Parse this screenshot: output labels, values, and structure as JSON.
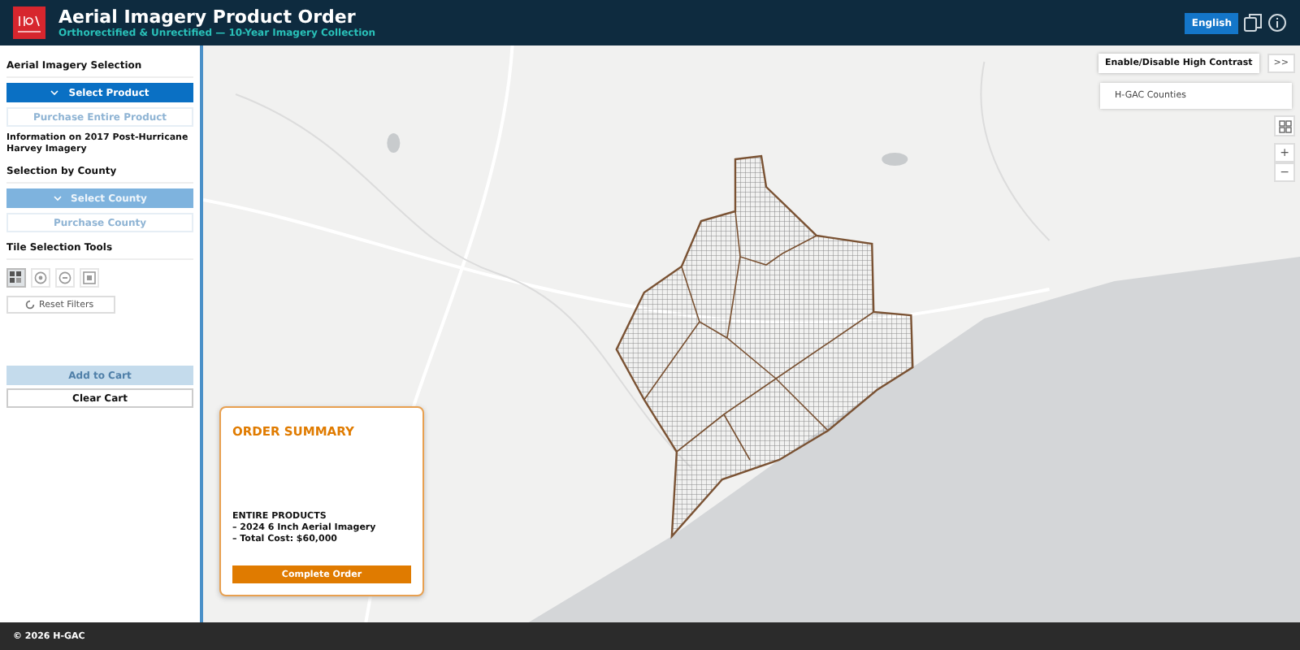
{
  "header": {
    "title": "Aerial Imagery Product Order",
    "subtitle": "Orthorectified & Unrectified — 10-Year Imagery Collection",
    "language_button": "English"
  },
  "sidebar": {
    "sections": [
      {
        "heading": "Aerial Imagery Selection",
        "buttons": [
          {
            "label": "Select Product",
            "kind": "dropdown",
            "disabled": false
          },
          {
            "label": "Purchase Entire Product",
            "kind": "plain",
            "disabled": true
          }
        ],
        "info": "Information on 2017 Post-Hurricane Harvey Imagery"
      },
      {
        "heading": "Selection by County",
        "buttons": [
          {
            "label": "Select County",
            "kind": "dropdown",
            "disabled": true
          },
          {
            "label": "Purchase County",
            "kind": "plain",
            "disabled": true
          }
        ]
      },
      {
        "heading": "Tile Selection Tools",
        "tools": [
          {
            "kind": "grid",
            "selected": true
          },
          {
            "kind": "add",
            "selected": false
          },
          {
            "kind": "remove",
            "selected": false
          },
          {
            "kind": "extent",
            "selected": false
          }
        ],
        "reset_button": "Reset Filters"
      }
    ],
    "cart_buttons": [
      {
        "label": "Add to Cart",
        "disabled": true
      },
      {
        "label": "Clear Cart",
        "disabled": false
      }
    ]
  },
  "map": {
    "high_contrast_button": "Enable/Disable High Contrast",
    "expand_button": ">>",
    "layer_panel": "H-GAC Counties",
    "zoom_in": "+",
    "zoom_out": "−"
  },
  "order_summary": {
    "title": "ORDER SUMMARY",
    "lines": [
      "ENTIRE PRODUCTS",
      "– 2024 6 Inch Aerial Imagery",
      "– Total Cost: $60,000"
    ],
    "button": "Complete Order"
  },
  "footer": {
    "text": "© 2026 H-GAC"
  }
}
